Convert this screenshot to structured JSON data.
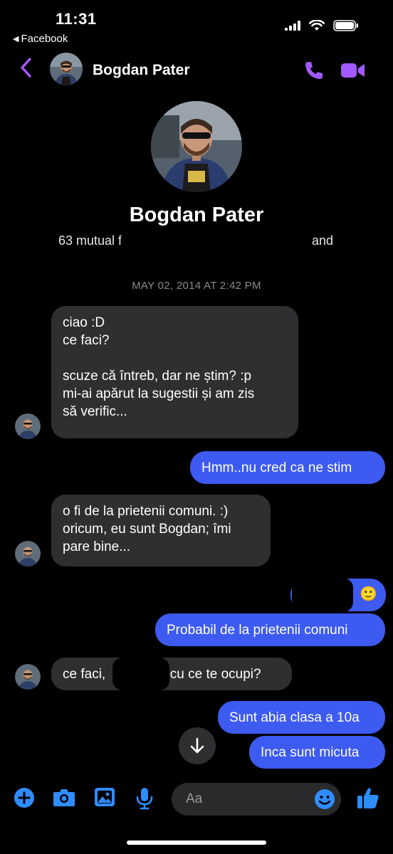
{
  "status": {
    "time": "11:31",
    "back_app": "Facebook"
  },
  "header": {
    "contact_name": "Bogdan Pater"
  },
  "profile": {
    "name": "Bogdan Pater",
    "mutual_start": "63 mutual fr",
    "mutual_end": "and"
  },
  "timestamp": "MAY 02, 2014 AT 2:42 PM",
  "messages": [
    {
      "from": "them",
      "text": "ciao :D\nce faci?\n\nscuze că întreb, dar ne știm? :p\nmi-ai apărut la sugestii și am zis\nsă verific..."
    },
    {
      "from": "me",
      "text": "Hmm..nu cred ca ne stim"
    },
    {
      "from": "them",
      "text": "o fi de la prietenii comuni. :)\noricum, eu sunt Bogdan; îmi\npare bine..."
    },
    {
      "from": "me",
      "text": "🙂"
    },
    {
      "from": "me",
      "text": "Probabil de la prietenii comuni"
    },
    {
      "from": "them",
      "text_before": "ce faci,",
      "text_after": ", cu ce te ocupi?"
    },
    {
      "from": "me",
      "text": "Sunt abia clasa a 10a"
    },
    {
      "from": "me",
      "text": "Inca sunt micuta"
    }
  ],
  "composer": {
    "placeholder": "Aa"
  },
  "colors": {
    "accent": "#a259ff",
    "outgoing_bubble": "#3d5bf0",
    "incoming_bubble": "#2f2f31",
    "toolbar_icon": "#2f8cff"
  },
  "icons": [
    "back-chevron-icon",
    "phone-icon",
    "video-camera-icon",
    "plus-icon",
    "camera-icon",
    "image-icon",
    "microphone-icon",
    "emoji-icon",
    "thumbs-up-icon",
    "arrow-down-icon"
  ]
}
